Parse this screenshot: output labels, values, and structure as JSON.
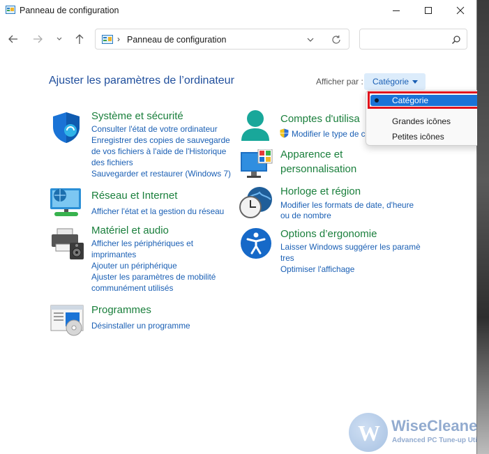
{
  "window": {
    "title": "Panneau de configuration"
  },
  "address_bar": {
    "path": "Panneau de configuration",
    "separator": "›"
  },
  "search": {
    "placeholder": ""
  },
  "header": {
    "title": "Ajuster les paramètres de l’ordinateur",
    "view_by_label": "Afficher par :",
    "view_by_value": "Catégorie"
  },
  "view_menu": {
    "items": [
      "Catégorie",
      "Grandes icônes",
      "Petites icônes"
    ],
    "selected_index": 0
  },
  "categories": [
    {
      "title": "Système et sécurité",
      "icon": "shield-icon",
      "links": [
        "Consulter l'état de votre ordinateur",
        "Enregistrer des copies de sauvegarde",
        "de vos fichiers à l'aide de l'Historique",
        "des fichiers",
        "Sauvegarder et restaurer (Windows 7)"
      ]
    },
    {
      "title": "Réseau et Internet",
      "icon": "network-globe-icon",
      "links": [
        "Afficher l'état et la gestion du réseau"
      ]
    },
    {
      "title": "Matériel et audio",
      "icon": "printer-speaker-icon",
      "links": [
        "Afficher les périphériques et",
        "imprimantes",
        "Ajouter un périphérique",
        "Ajuster les paramètres de mobilité",
        "communément utilisés"
      ]
    },
    {
      "title": "Programmes",
      "icon": "programs-disc-icon",
      "links": [
        "Désinstaller un programme"
      ]
    },
    {
      "title": "Comptes d'utilisa",
      "icon": "user-account-icon",
      "links": [
        "Modifier le type de c"
      ]
    },
    {
      "title_lines": [
        "Apparence et",
        "personnalisation"
      ],
      "icon": "appearance-monitor-icon",
      "links": []
    },
    {
      "title": "Horloge et région",
      "icon": "clock-globe-icon",
      "links": [
        "Modifier les formats de date, d'heure",
        "ou de nombre"
      ]
    },
    {
      "title": "Options d’ergonomie",
      "icon": "accessibility-icon",
      "links": [
        "Laisser Windows suggérer les paramè",
        "tres",
        "Optimiser l'affichage"
      ]
    }
  ],
  "watermark": {
    "letter": "W",
    "name": "WiseCleane",
    "tagline": "Advanced PC Tune-up Utilit"
  },
  "colors": {
    "category_title": "#1a7f3c",
    "link": "#1a5fb4",
    "page_title": "#1f4e9c",
    "menu_selected": "#1a73d6",
    "highlight": "#e0121c"
  }
}
